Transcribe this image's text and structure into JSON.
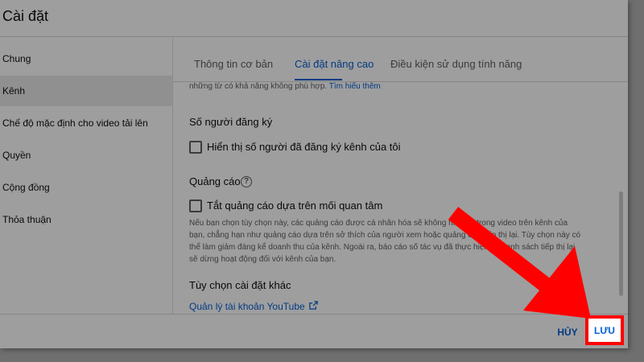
{
  "dialog": {
    "title": "Cài đặt"
  },
  "sidebar": {
    "items": [
      {
        "label": "Chung"
      },
      {
        "label": "Kênh"
      },
      {
        "label": "Chế độ mặc định cho video tải lên"
      },
      {
        "label": "Quyền"
      },
      {
        "label": "Cộng đồng"
      },
      {
        "label": "Thỏa thuận"
      }
    ],
    "active_index": 1
  },
  "tabs": [
    {
      "label": "Thông tin cơ bản"
    },
    {
      "label": "Cài đặt nâng cao"
    },
    {
      "label": "Điều kiện sử dụng tính năng"
    }
  ],
  "content": {
    "truncated_text": "những từ có khả năng không phù hợp.",
    "learn_more_link": "Tìm hiểu thêm",
    "subscribers": {
      "heading": "Số người đăng ký",
      "checkbox_label": "Hiển thị số người đã đăng ký kênh của tôi",
      "checked": false
    },
    "ads": {
      "heading": "Quảng cáo",
      "help_icon": "help-circle-icon",
      "checkbox_label": "Tắt quảng cáo dựa trên mối quan tâm",
      "checked": false,
      "description_lines": [
        "Nếu bạn chọn tùy chọn này, các quảng cáo được cá nhân hóa sẽ không hiển thị trong video trên kênh của",
        "bạn, chẳng hạn như quảng cáo dựa trên sở thích của người xem hoặc quảng cáo tiếp thị lại. Tùy chọn này có",
        "thể làm giảm đáng kể doanh thu của kênh. Ngoài ra, báo cáo số tác vụ đã thực hiện và danh sách tiếp thị lại",
        "sẽ dừng hoạt động đối với kênh của bạn."
      ]
    },
    "other": {
      "heading": "Tùy chọn cài đặt khác",
      "link_label": "Quản lý tài khoản YouTube",
      "link_icon": "external-link-icon"
    }
  },
  "footer": {
    "cancel_label": "HỦY",
    "save_label": "LƯU"
  },
  "colors": {
    "accent": "#065fd4",
    "highlight": "#ff0000",
    "overlay": "#6f6f6f"
  }
}
